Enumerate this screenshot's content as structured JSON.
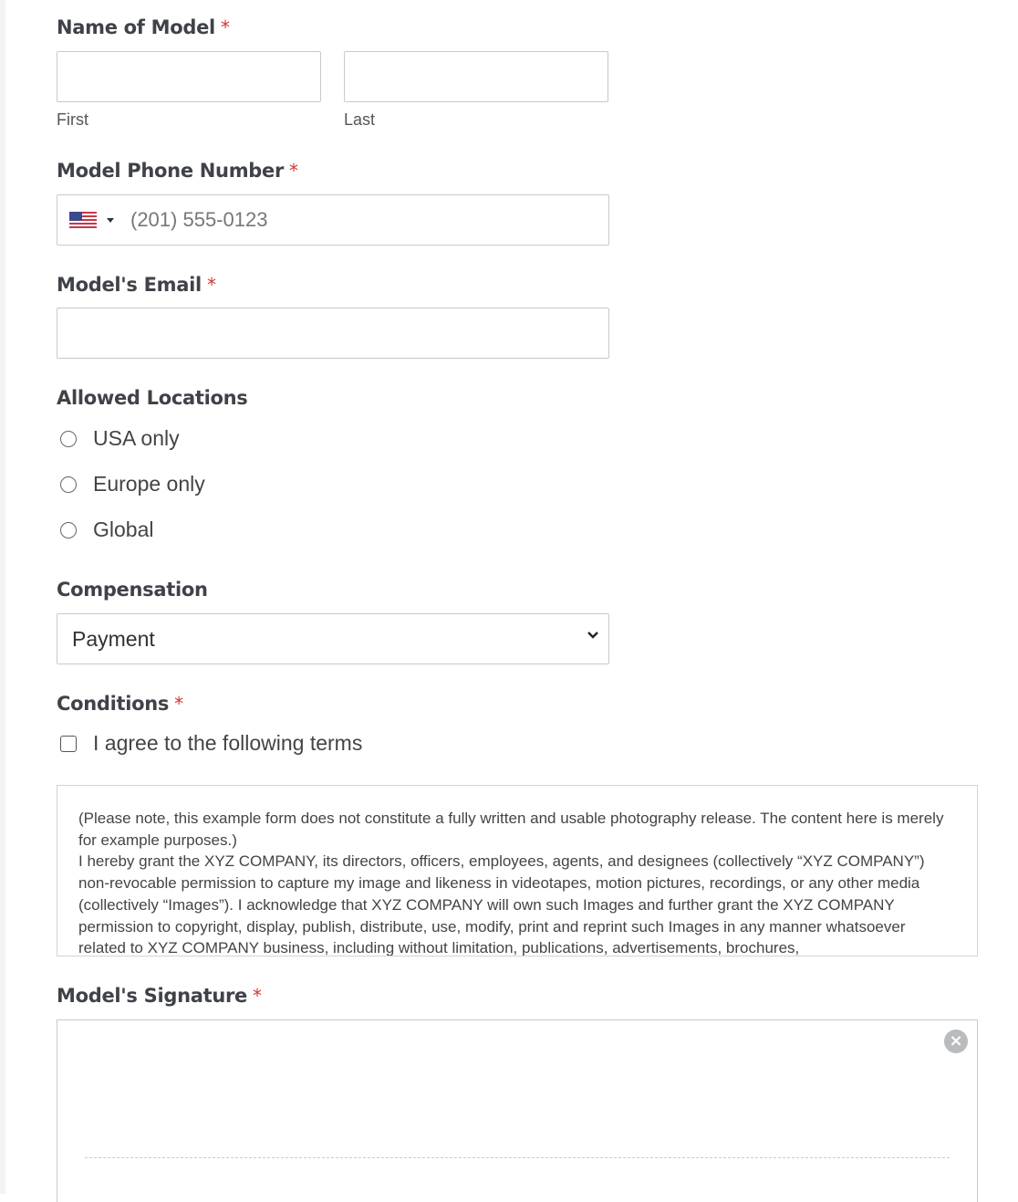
{
  "form": {
    "name": {
      "label": "Name of Model",
      "required_mark": "*",
      "first": {
        "value": "",
        "sublabel": "First"
      },
      "last": {
        "value": "",
        "sublabel": "Last"
      }
    },
    "phone": {
      "label": "Model Phone Number",
      "required_mark": "*",
      "country_icon": "us-flag-icon",
      "placeholder": "(201) 555-0123",
      "value": ""
    },
    "email": {
      "label": "Model's Email",
      "required_mark": "*",
      "value": ""
    },
    "locations": {
      "label": "Allowed Locations",
      "options": [
        {
          "label": "USA only",
          "selected": false
        },
        {
          "label": "Europe only",
          "selected": false
        },
        {
          "label": "Global",
          "selected": false
        }
      ]
    },
    "compensation": {
      "label": "Compensation",
      "selected": "Payment"
    },
    "conditions": {
      "label": "Conditions",
      "required_mark": "*",
      "checkbox_label": "I agree to the following terms",
      "checked": false,
      "terms_para1": "(Please note, this example form does not constitute a fully written and usable photography release. The content here is merely for example purposes.)",
      "terms_para2": "I hereby grant the XYZ COMPANY, its directors, officers, employees, agents, and designees (collectively “XYZ COMPANY”) non-revocable permission to capture my image and likeness in videotapes, motion pictures, recordings, or any other media (collectively “Images”). I acknowledge that XYZ COMPANY will own such Images and further grant the XYZ COMPANY permission to copyright, display, publish, distribute, use, modify, print and reprint such Images in any manner whatsoever related to XYZ COMPANY business, including without limitation, publications, advertisements, brochures,"
    },
    "signature": {
      "label": "Model's Signature",
      "required_mark": "*",
      "clear_icon": "×"
    }
  },
  "colors": {
    "required": "#d63637",
    "label": "#3f4248",
    "border": "#c9c9c9"
  }
}
